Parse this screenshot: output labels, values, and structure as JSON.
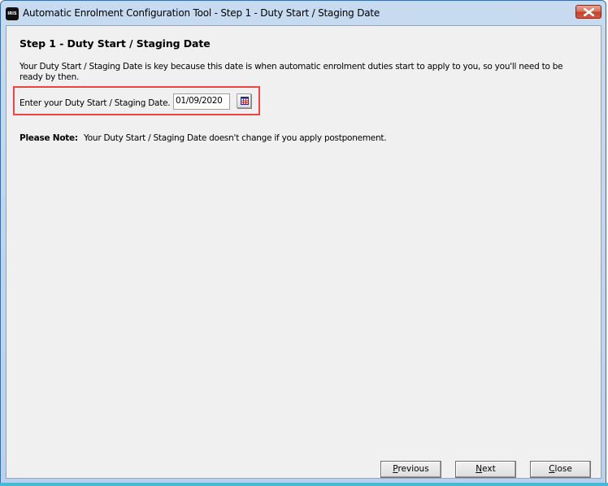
{
  "window": {
    "title": "Automatic Enrolment Configuration Tool - Step 1 - Duty Start / Staging Date",
    "app_icon": "IRIS",
    "close_icon": "close-icon"
  },
  "page": {
    "step_title": "Step 1 - Duty Start / Staging Date",
    "intro_text": "Your Duty Start / Staging Date is key because this date is when automatic enrolment duties start to apply to you, so you'll need to be ready by then.",
    "date_label": "Enter your Duty Start / Staging Date.",
    "date_value": "01/09/2020",
    "calendar_icon": "calendar-icon",
    "note_label": "Please Note:",
    "note_text": "Your Duty Start / Staging Date doesn't change if you apply postponement.",
    "highlight_color": "#ee4444"
  },
  "buttons": {
    "previous": {
      "accel": "P",
      "rest": "revious"
    },
    "next": {
      "accel": "N",
      "rest": "ext"
    },
    "close": {
      "accel": "C",
      "rest": "lose"
    }
  }
}
